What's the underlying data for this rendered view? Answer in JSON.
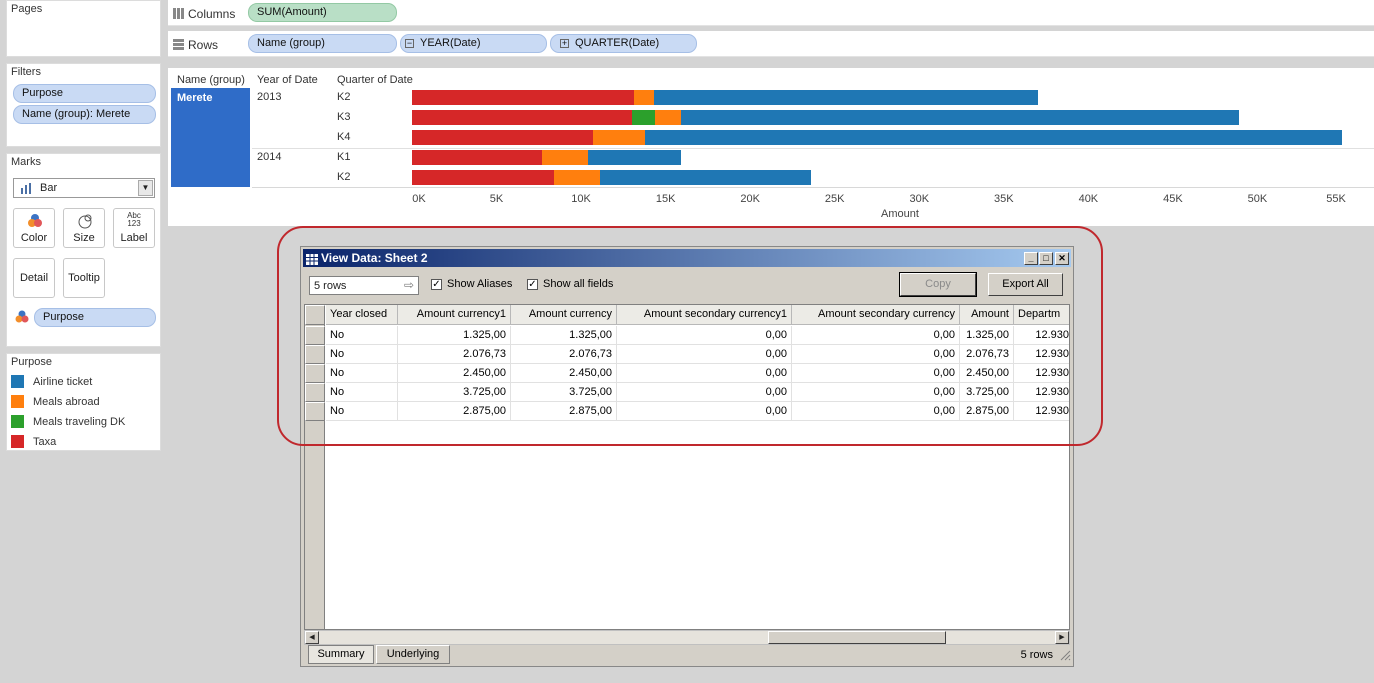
{
  "sidebar": {
    "pages_title": "Pages",
    "filters_title": "Filters",
    "filters": [
      "Purpose",
      "Name (group): Merete"
    ],
    "marks_title": "Marks",
    "mark_type": "Bar",
    "mark_buttons": {
      "color": "Color",
      "size": "Size",
      "label": "Label",
      "label_icon": "Abc\n123",
      "detail": "Detail",
      "tooltip": "Tooltip"
    },
    "color_field": "Purpose",
    "legend_title": "Purpose",
    "legend": [
      {
        "label": "Airline ticket",
        "color": "#1f77b4"
      },
      {
        "label": "Meals abroad",
        "color": "#ff7f0e"
      },
      {
        "label": "Meals traveling DK",
        "color": "#2ca02c"
      },
      {
        "label": "Taxa",
        "color": "#d62728"
      }
    ]
  },
  "shelves": {
    "columns_label": "Columns",
    "columns_pill": "SUM(Amount)",
    "rows_label": "Rows",
    "rows_pills": [
      "Name (group)",
      "YEAR(Date)",
      "QUARTER(Date)"
    ],
    "rows_pill_icons": [
      "",
      "−",
      "+"
    ]
  },
  "chart_headers": {
    "name": "Name (group)",
    "year": "Year of Date",
    "quarter": "Quarter of Date"
  },
  "chart_data": {
    "type": "bar",
    "orientation": "horizontal",
    "stacked": true,
    "name_group": "Merete",
    "rows": [
      {
        "year": "2013",
        "quarter": "K2",
        "segments": [
          {
            "series": "Taxa",
            "value": 13100
          },
          {
            "series": "Meals abroad",
            "value": 1200
          },
          {
            "series": "Airline ticket",
            "value": 22700
          }
        ]
      },
      {
        "year": "2013",
        "quarter": "K3",
        "segments": [
          {
            "series": "Taxa",
            "value": 13000
          },
          {
            "series": "Meals traveling DK",
            "value": 1400
          },
          {
            "series": "Meals abroad",
            "value": 1500
          },
          {
            "series": "Airline ticket",
            "value": 33000
          }
        ]
      },
      {
        "year": "2013",
        "quarter": "K4",
        "segments": [
          {
            "series": "Taxa",
            "value": 10700
          },
          {
            "series": "Meals abroad",
            "value": 3100
          },
          {
            "series": "Airline ticket",
            "value": 41200
          }
        ]
      },
      {
        "year": "2014",
        "quarter": "K1",
        "segments": [
          {
            "series": "Taxa",
            "value": 7700
          },
          {
            "series": "Meals abroad",
            "value": 2700
          },
          {
            "series": "Airline ticket",
            "value": 5500
          }
        ]
      },
      {
        "year": "2014",
        "quarter": "K2",
        "segments": [
          {
            "series": "Taxa",
            "value": 8400
          },
          {
            "series": "Meals abroad",
            "value": 2700
          },
          {
            "series": "Airline ticket",
            "value": 12500
          }
        ]
      }
    ],
    "xlabel": "Amount",
    "xlim": [
      0,
      55000
    ],
    "xticks": [
      "0K",
      "5K",
      "10K",
      "15K",
      "20K",
      "25K",
      "30K",
      "35K",
      "40K",
      "45K",
      "50K",
      "55K"
    ],
    "series_colors": {
      "Taxa": "#d62728",
      "Meals abroad": "#ff7f0e",
      "Meals traveling DK": "#2ca02c",
      "Airline ticket": "#1f77b4"
    }
  },
  "dialog": {
    "title": "View Data:  Sheet 2",
    "rows_box": "5 rows",
    "show_aliases": "Show Aliases",
    "show_all_fields": "Show all fields",
    "copy": "Copy",
    "export_all": "Export All",
    "columns": [
      "Year closed",
      "Amount currency1",
      "Amount currency",
      "Amount secondary currency1",
      "Amount secondary currency",
      "Amount",
      "Departm"
    ],
    "rows": [
      [
        "No",
        "1.325,00",
        "1.325,00",
        "0,00",
        "0,00",
        "1.325,00",
        "12.930"
      ],
      [
        "No",
        "2.076,73",
        "2.076,73",
        "0,00",
        "0,00",
        "2.076,73",
        "12.930"
      ],
      [
        "No",
        "2.450,00",
        "2.450,00",
        "0,00",
        "0,00",
        "2.450,00",
        "12.930"
      ],
      [
        "No",
        "3.725,00",
        "3.725,00",
        "0,00",
        "0,00",
        "3.725,00",
        "12.930"
      ],
      [
        "No",
        "2.875,00",
        "2.875,00",
        "0,00",
        "0,00",
        "2.875,00",
        "12.930"
      ]
    ],
    "tabs": [
      "Summary",
      "Underlying"
    ],
    "status": "5 rows"
  },
  "colors": {
    "annotation": "#c0282d",
    "name_header": "#2f6cc8",
    "pill": "#c9daf4"
  }
}
